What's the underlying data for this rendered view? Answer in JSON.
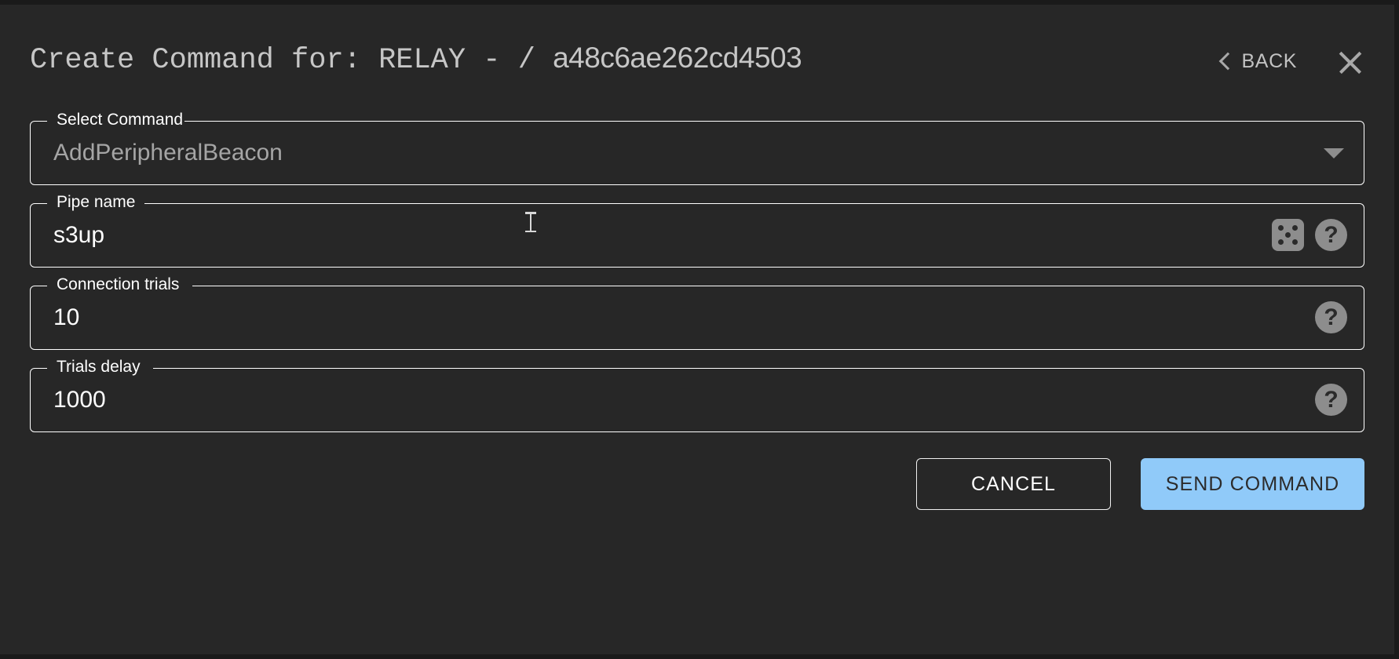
{
  "header": {
    "title_prefix": "Create Command for: RELAY - / ",
    "device_id": "a48c6ae262cd4503",
    "back_label": "BACK",
    "back_icon": "chevron-left-icon",
    "close_icon": "close-icon"
  },
  "fields": {
    "select_command": {
      "label": "Select Command",
      "value": "AddPeripheralBeacon",
      "arrow_icon": "chevron-down-icon"
    },
    "pipe_name": {
      "label": "Pipe name",
      "value": "s3up",
      "dice_icon": "dice-icon",
      "help_icon": "help-icon",
      "help_glyph": "?"
    },
    "connection_trials": {
      "label": "Connection trials",
      "value": "10",
      "help_icon": "help-icon",
      "help_glyph": "?"
    },
    "trials_delay": {
      "label": "Trials delay",
      "value": "1000",
      "help_icon": "help-icon",
      "help_glyph": "?"
    }
  },
  "actions": {
    "cancel_label": "CANCEL",
    "send_label": "SEND COMMAND"
  },
  "colors": {
    "background": "#272727",
    "outline": "#ffffff",
    "label": "#ffffff",
    "title": "#c6c6c6",
    "muted_value": "#a5a5a5",
    "accent": "#90caf9",
    "icon_gray": "#8d8d8d"
  }
}
